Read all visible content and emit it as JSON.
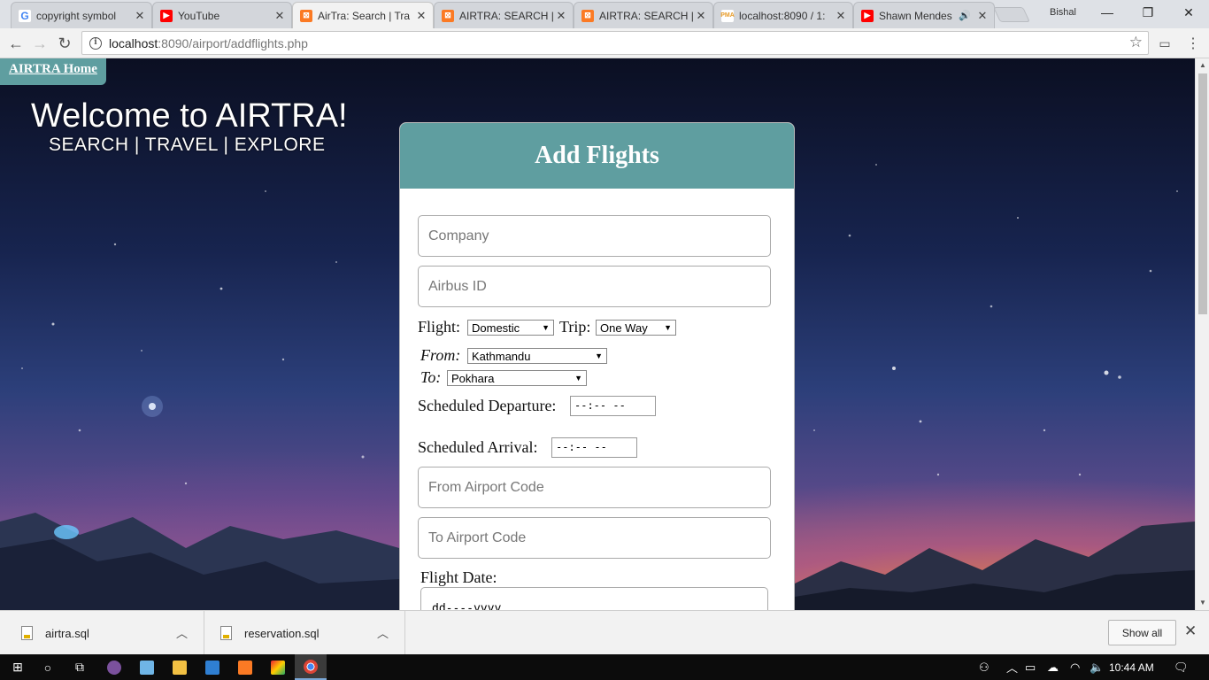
{
  "tabs": [
    {
      "title": "copyright symbol",
      "icon": "google-icon",
      "color": "#4285f4",
      "active": false
    },
    {
      "title": "YouTube",
      "icon": "youtube-icon",
      "color": "#ff0000",
      "active": false
    },
    {
      "title": "AirTra: Search | Tra",
      "icon": "xampp-icon",
      "color": "#fb7a24",
      "active": true
    },
    {
      "title": "AIRTRA: SEARCH |",
      "icon": "xampp-icon",
      "color": "#fb7a24",
      "active": false
    },
    {
      "title": "AIRTRA: SEARCH |",
      "icon": "xampp-icon",
      "color": "#fb7a24",
      "active": false
    },
    {
      "title": "localhost:8090 / 1:",
      "icon": "phpmyadmin-icon",
      "color": "#6c78af",
      "active": false
    },
    {
      "title": "Shawn Mendes",
      "icon": "youtube-icon",
      "color": "#ff0000",
      "active": false
    }
  ],
  "profile_name": "Bishal",
  "address": {
    "host": "localhost",
    "path": ":8090/airport/addflights.php"
  },
  "page": {
    "home_link": "AIRTRA Home",
    "welcome": "Welcome to AIRTRA!",
    "tagline": "SEARCH | TRAVEL | EXPLORE",
    "form_title": "Add Flights",
    "company_placeholder": "Company",
    "airbus_placeholder": "Airbus ID",
    "flight_label": "Flight:",
    "flight_value": "Domestic",
    "trip_label": "Trip:",
    "trip_value": "One Way",
    "from_label": "From:",
    "from_value": "Kathmandu",
    "to_label": "To:",
    "to_value": "Pokhara",
    "departure_label": "Scheduled Departure:",
    "departure_value": "--:-- --",
    "arrival_label": "Scheduled Arrival:",
    "arrival_value": "--:-- --",
    "from_code_placeholder": "From Airport Code",
    "to_code_placeholder": "To Airport Code",
    "flight_date_label": "Flight Date:",
    "flight_date_value": "dd----yyyy"
  },
  "downloads": {
    "items": [
      {
        "name": "airtra.sql"
      },
      {
        "name": "reservation.sql"
      }
    ],
    "show_all": "Show all"
  },
  "taskbar": {
    "time": "10:44 AM"
  },
  "colors": {
    "accent": "#5f9ea0"
  }
}
